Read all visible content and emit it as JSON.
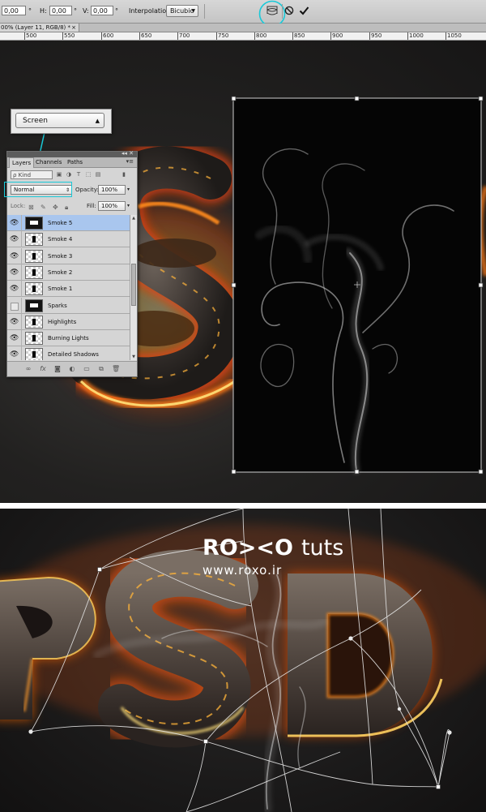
{
  "options_bar": {
    "h_label": "H:",
    "h_value": "0,00",
    "v_label": "V:",
    "v_value": "0,00",
    "degree_symbol": "°",
    "first_value": "0,00",
    "interpolation_label": "Interpolation:",
    "interpolation_value": "Bicubic",
    "highlight_color": "#19c9d8"
  },
  "document_tab": {
    "title": "00% (Layer 11, RGB/8) *",
    "close": "×"
  },
  "ruler": {
    "labels": [
      "500",
      "550",
      "600",
      "650",
      "700",
      "750",
      "800",
      "850",
      "900",
      "950",
      "1000",
      "1050"
    ]
  },
  "blend_popup": {
    "value": "Screen"
  },
  "layers_panel": {
    "collapse": "◂◂ ✕",
    "menu": "▾≡",
    "tabs": [
      "Layers",
      "Channels",
      "Paths"
    ],
    "kind_label": "ρ Kind",
    "blend_mode": "Normal",
    "opacity_label": "Opacity:",
    "opacity_value": "100%",
    "lock_label": "Lock:",
    "fill_label": "Fill:",
    "fill_value": "100%",
    "layers": [
      {
        "name": "Smoke 5",
        "visible": true,
        "selected": true
      },
      {
        "name": "Smoke 4",
        "visible": true,
        "selected": false
      },
      {
        "name": "Smoke 3",
        "visible": true,
        "selected": false
      },
      {
        "name": "Smoke 2",
        "visible": true,
        "selected": false
      },
      {
        "name": "Smoke 1",
        "visible": true,
        "selected": false
      },
      {
        "name": "Sparks",
        "visible": false,
        "selected": false
      },
      {
        "name": "Highlights",
        "visible": true,
        "selected": false
      },
      {
        "name": "Burning Lights",
        "visible": true,
        "selected": false
      },
      {
        "name": "Detailed Shadows",
        "visible": true,
        "selected": false
      }
    ]
  },
  "watermark": {
    "logo": "RO><O",
    "tuts": "tuts",
    "site": "www.roxo.ir"
  }
}
